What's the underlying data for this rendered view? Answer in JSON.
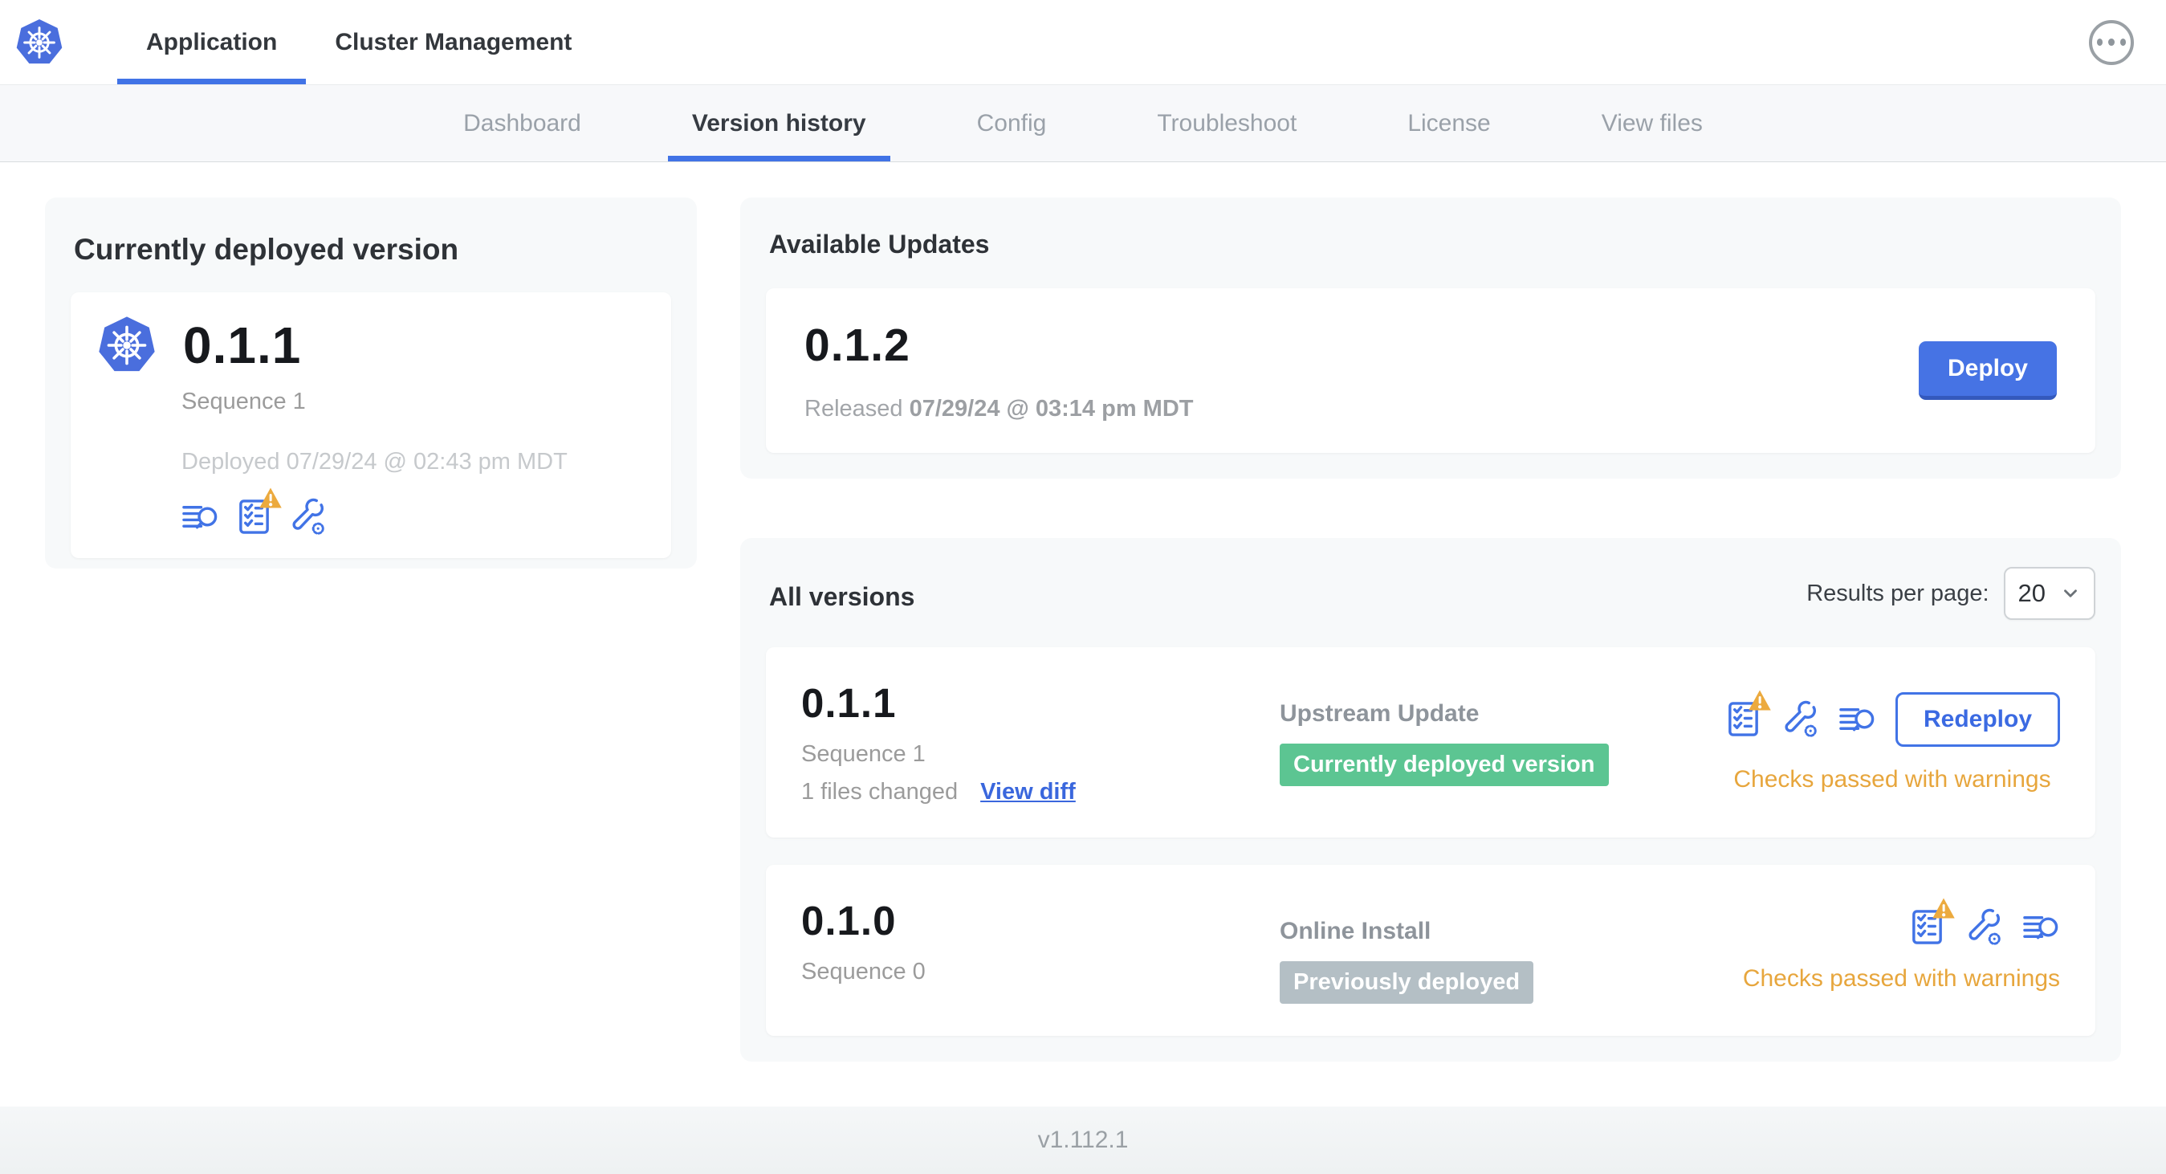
{
  "header": {
    "logo_icon": "kubernetes-logo",
    "tabs": [
      {
        "label": "Application"
      },
      {
        "label": "Cluster Management"
      }
    ],
    "active_tab": "Application",
    "menu_icon": "ellipsis-menu"
  },
  "subnav": {
    "tabs": [
      {
        "label": "Dashboard"
      },
      {
        "label": "Version history"
      },
      {
        "label": "Config"
      },
      {
        "label": "Troubleshoot"
      },
      {
        "label": "License"
      },
      {
        "label": "View files"
      }
    ],
    "active_tab": "Version history"
  },
  "current_version": {
    "title": "Currently deployed version",
    "app_icon": "kubernetes-app-icon",
    "version": "0.1.1",
    "sequence": "Sequence 1",
    "deployed": "Deployed 07/29/24 @ 02:43 pm MDT",
    "icons": [
      "deploy-logs-icon",
      "preflight-checks-warning-icon",
      "edit-config-icon"
    ]
  },
  "available_updates": {
    "title": "Available Updates",
    "update": {
      "version": "0.1.2",
      "released_label": "Released",
      "released_date": "07/29/24 @ 03:14 pm MDT",
      "deploy_button": "Deploy"
    }
  },
  "all_versions": {
    "title": "All versions",
    "results_per_page_label": "Results per page:",
    "results_per_page_value": "20",
    "rows": [
      {
        "version": "0.1.1",
        "sequence": "Sequence 1",
        "files_changed": "1 files changed",
        "view_diff_link": "View diff",
        "source": "Upstream Update",
        "badge": "Currently deployed version",
        "badge_color": "#5cc592",
        "icons": [
          "preflight-checks-warning-icon",
          "edit-config-icon",
          "deploy-logs-icon"
        ],
        "action_button": "Redeploy",
        "status": "Checks passed with warnings"
      },
      {
        "version": "0.1.0",
        "sequence": "Sequence 0",
        "source": "Online Install",
        "badge": "Previously deployed",
        "badge_color": "#b4bfc5",
        "icons": [
          "preflight-checks-warning-icon",
          "edit-config-icon",
          "deploy-logs-icon"
        ],
        "status": "Checks passed with warnings"
      }
    ]
  },
  "footer": {
    "app_version": "v1.112.1"
  },
  "colors": {
    "accent_blue": "#4173e6",
    "kubernetes_blue": "#4a6edd",
    "green_badge": "#5cc592",
    "gray_badge": "#b4bfc5",
    "warning_amber": "#e7a63d",
    "panel_bg": "#f7f9fa"
  }
}
